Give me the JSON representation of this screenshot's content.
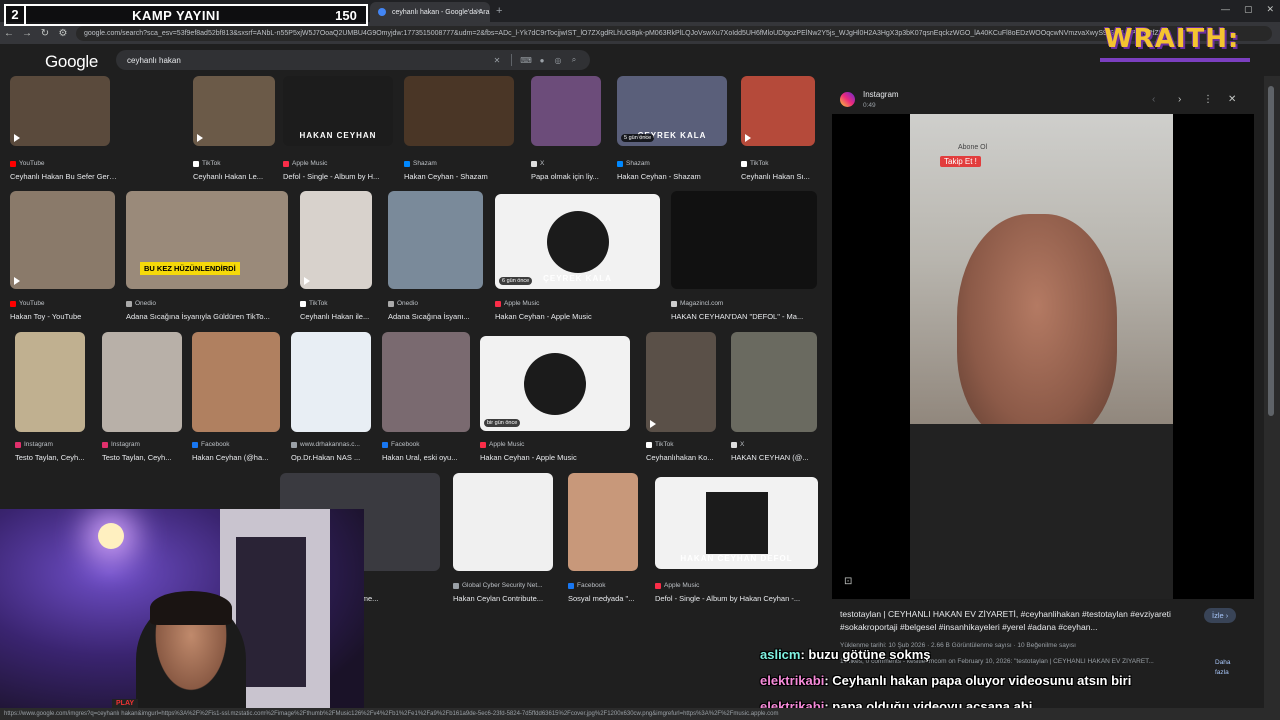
{
  "overlay": {
    "number": "2",
    "title": "KAMP YAYINI",
    "count": "150"
  },
  "brand": {
    "logo_text": "WRAITH:"
  },
  "browser": {
    "tabs": [
      {
        "label": "a93qd2m.png - Hızlı Resim"
      },
      {
        "label": "Gelen Kutusu (58) - bishop"
      },
      {
        "label": "ceyhanlı hakan - Google'da Ara"
      }
    ],
    "url": "google.com/search?sca_esv=53f9ef8ad52bf813&sxsrf=ANbL-n55P5xjW5J7OoaQ2UMBU4G9Omyjdw:1773515008777&udm=2&fbs=ADc_l-Yk7dC9rTocjjwIST_lO7ZXgdRLhUG8pk-pM063RkPlLQJoVswXu7XoIdd5UH6fMloUDtgozPElNw2Y5js_WJgHl0H2A3HgX3p3bK07qsnEqckzWGO_lA40KCuFl8oEDzWOOqcwNVmzvaXwyS9fGfb4JxPaF4PfZ9"
  },
  "google": {
    "logo": "Google",
    "query": "ceyhanlı hakan"
  },
  "results": [
    {
      "source": "YouTube",
      "caption": "Ceyhanlı Hakan Bu Sefer Gerçekten YANDI...",
      "badge": ""
    },
    {
      "source": "TikTok",
      "caption": "Ceyhanlı Hakan Le...",
      "badge": ""
    },
    {
      "source": "Apple Music",
      "caption": "Defol - Single - Album by H...",
      "badge": "",
      "overlay_text": "HAKAN CEYHAN"
    },
    {
      "source": "Shazam",
      "caption": "Hakan Ceyhan - Shazam",
      "badge": ""
    },
    {
      "source": "X",
      "caption": "Papa olmak için liy...",
      "badge": ""
    },
    {
      "source": "Shazam",
      "caption": "Hakan Ceyhan - Shazam",
      "badge": "5 gün önce",
      "overlay_text": "ÇEYREK KALA"
    },
    {
      "source": "TikTok",
      "caption": "Ceyhanlı Hakan Sı...",
      "badge": ""
    },
    {
      "source": "YouTube",
      "caption": "Hakan Toy - YouTube",
      "badge": ""
    },
    {
      "source": "Onedio",
      "caption": "Adana Sıcağına İsyanıyla Güldüren TikTo...",
      "badge": "",
      "overlay_text": "BU KEZ HÜZÜNLENDİRDİ"
    },
    {
      "source": "TikTok",
      "caption": "Ceyhanlı Hakan ile...",
      "badge": ""
    },
    {
      "source": "Onedio",
      "caption": "Adana Sıcağına İsyanı...",
      "badge": ""
    },
    {
      "source": "Apple Music",
      "caption": "Hakan Ceyhan - Apple Music",
      "badge": "6 gün önce",
      "overlay_text": "ÇEYREK KALA"
    },
    {
      "source": "Magazincl.com",
      "caption": "HAKAN CEYHAN'DAN \"DEFOL\" - Ma...",
      "badge": ""
    },
    {
      "source": "Instagram",
      "caption": "Testo Taylan, Ceyh...",
      "badge": ""
    },
    {
      "source": "Instagram",
      "caption": "Testo Taylan, Ceyh...",
      "badge": ""
    },
    {
      "source": "Facebook",
      "caption": "Hakan Ceyhan (@ha...",
      "badge": ""
    },
    {
      "source": "www.drhakannas.c...",
      "caption": "Op.Dr.Hakan NAS ...",
      "badge": ""
    },
    {
      "source": "Facebook",
      "caption": "Hakan Ural, eski oyu...",
      "badge": ""
    },
    {
      "source": "Apple Music",
      "caption": "Hakan Ceyhan - Apple Music",
      "badge": "bir gün önce"
    },
    {
      "source": "TikTok",
      "caption": "Ceyhanlıhakan Ko...",
      "badge": ""
    },
    {
      "source": "X",
      "caption": "HAKAN CEYHAN (@...",
      "badge": ""
    },
    {
      "source": "",
      "caption": "...hur sosyal medya fenome...",
      "badge": ""
    },
    {
      "source": "Global Cyber Security Net...",
      "caption": "Hakan Ceylan Contribute...",
      "badge": ""
    },
    {
      "source": "Facebook",
      "caption": "Sosyal medyada \"...",
      "badge": ""
    },
    {
      "source": "Apple Music",
      "caption": "Defol - Single - Album by Hakan Ceyhan -...",
      "badge": "",
      "overlay_text": "HAKAN CEYHAN DEFOL"
    }
  ],
  "panel": {
    "platform": "Instagram",
    "duration": "0:49",
    "media_text": {
      "abone": "Abone Ol",
      "follow": "Takip Et !"
    },
    "description": "testotaylan | CEYHANLI HAKAN EV ZİYARETİ, #ceyhanlihakan #testotaylan #evziyareti #sokakroportaji #belgesel #insanhikayeleri #yerel #adana #ceyhan...",
    "watch": "İzle ›",
    "meta": "Yüklenme tarihi: 10 Şub 2026 · 2.66 B Görüntülenme sayısı · 10 Beğenilme sayısı",
    "meta2": "10 likes, 0 comments - kesitlerimcom on February 10, 2026: \"testotaylan | CEYHANLI HAKAN EV ZİYARET...",
    "more": "Daha fazla"
  },
  "webcam": {
    "plate": "PLAY"
  },
  "chat": [
    {
      "user": "aslicm",
      "message": ": buzu götüne sokmş"
    },
    {
      "user": "elektrikabi",
      "message": ": Ceyhanlı hakan papa oluyor videosunu atsın biri"
    },
    {
      "user": "elektrikabi",
      "message": ": papa olduğu videoyu açsana abi"
    }
  ],
  "status_url": "https://www.google.com/imgres?q=ceyhanlı hakan&imgurl=https%3A%2F%2Fis1-ssl.mzstatic.com%2Fimage%2Fthumb%2FMusic126%2Fv4%2Fb1%2Fe1%2Fa9%2Fb161a9de-5ec6-23fd-5824-7d5ffdd63615%2Fcover.jpg%2F1200x630cw.png&imgrefurl=https%3A%2F%2Fmusic.apple.com"
}
